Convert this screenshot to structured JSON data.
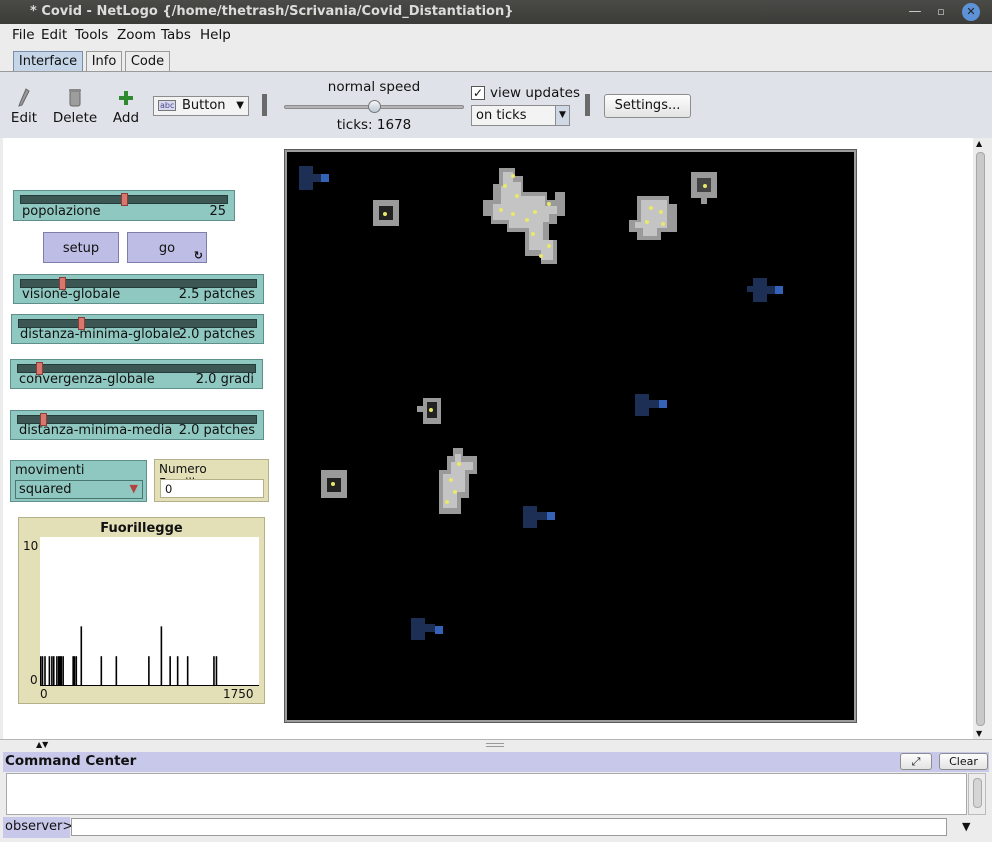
{
  "window": {
    "title": "* Covid - NetLogo {/home/thetrash/Scrivania/Covid_Distantiation}"
  },
  "menu": [
    "File",
    "Edit",
    "Tools",
    "Zoom",
    "Tabs",
    "Help"
  ],
  "tabs": [
    "Interface",
    "Info",
    "Code"
  ],
  "toolbar": {
    "edit_label": "Edit",
    "delete_label": "Delete",
    "add_label": "Add",
    "widget_type": "Button",
    "speed_label": "normal speed",
    "speed_value": 0.5,
    "ticks_label": "ticks: 1678",
    "view_updates_label": "view updates",
    "view_updates_checked": true,
    "update_mode": "on ticks",
    "settings_label": "Settings..."
  },
  "widgets": {
    "popolazione": {
      "label": "popolazione",
      "value": "25",
      "fraction": 0.5
    },
    "setup_label": "setup",
    "go_label": "go",
    "visione": {
      "label": "visione-globale",
      "value": "2.5 patches",
      "fraction": 0.17
    },
    "distanza_globale": {
      "label": "distanza-minima-globale",
      "value": "2.0 patches",
      "fraction": 0.26
    },
    "convergenza": {
      "label": "convergenza-globale",
      "value": "2.0 gradi",
      "fraction": 0.08
    },
    "distanza_media": {
      "label": "distanza-minima-media",
      "value": "2.0 patches",
      "fraction": 0.1
    },
    "movimenti": {
      "label": "movimenti",
      "value": "squared"
    },
    "monitor": {
      "label": "Numero Fuorilleg...",
      "value": "0"
    }
  },
  "chart_data": {
    "type": "line",
    "title": "Fuorillegge",
    "xlim": [
      0,
      1750
    ],
    "ylim": [
      0,
      10
    ],
    "x_tick_labels": [
      "0",
      "1750"
    ],
    "y_tick_labels": [
      "10",
      "0"
    ],
    "series": [
      {
        "spikes": [
          [
            5,
            2
          ],
          [
            20,
            2
          ],
          [
            40,
            2
          ],
          [
            75,
            2
          ],
          [
            95,
            2
          ],
          [
            110,
            2
          ],
          [
            135,
            2
          ],
          [
            150,
            2
          ],
          [
            160,
            2
          ],
          [
            170,
            2
          ],
          [
            185,
            2
          ],
          [
            265,
            2
          ],
          [
            275,
            2
          ],
          [
            290,
            2
          ],
          [
            330,
            4
          ],
          [
            490,
            2
          ],
          [
            610,
            2
          ],
          [
            870,
            2
          ],
          [
            970,
            4
          ],
          [
            1040,
            2
          ],
          [
            1100,
            2
          ],
          [
            1180,
            2
          ],
          [
            1390,
            2
          ],
          [
            1410,
            2
          ]
        ]
      }
    ]
  },
  "command_center": {
    "title": "Command Center",
    "clear_label": "Clear",
    "prompt": "observer>"
  },
  "colors": {
    "slider": "#8fc8c0",
    "button": "#bdbde6",
    "monitor": "#e3e0b8",
    "world_bg": "#000000",
    "agent_blue": "#1e2f55"
  }
}
